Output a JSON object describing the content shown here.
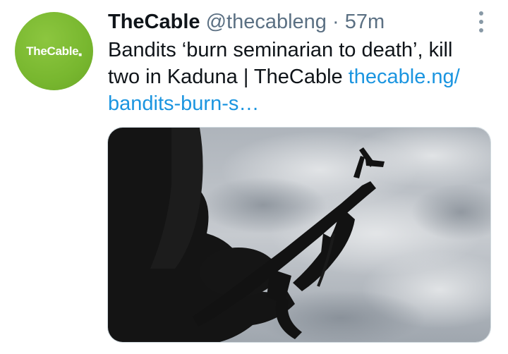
{
  "account": {
    "avatar_label": "TheCable",
    "display_name": "TheCable",
    "handle": "@thecableng",
    "separator": "·",
    "time": "57m"
  },
  "tweet": {
    "text": "Bandits ‘burn seminarian to death’, kill two in Kaduna | TheCable ",
    "link_text": "thecable.ng/ bandits-burn-s…"
  },
  "icons": {
    "more": "more-vertical-icon"
  },
  "colors": {
    "brand_green": "#78b72f",
    "link_blue": "#1b95e0",
    "secondary_text": "#5b7083"
  }
}
